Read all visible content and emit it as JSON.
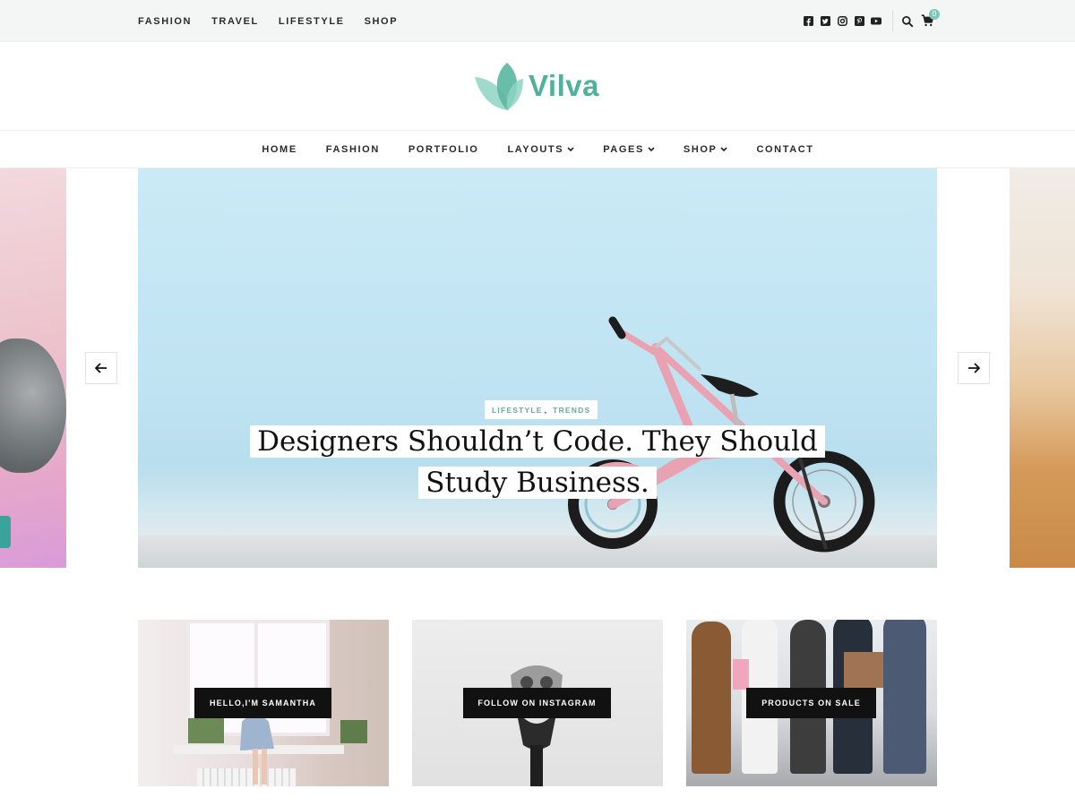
{
  "top_nav": [
    "Fashion",
    "Travel",
    "Lifestyle",
    "Shop"
  ],
  "social": [
    "facebook-icon",
    "twitter-icon",
    "instagram-icon",
    "pinterest-icon",
    "youtube-icon"
  ],
  "cart": {
    "count": "0"
  },
  "brand": {
    "name": "Vilva",
    "color": "#4fb09b"
  },
  "main_nav": [
    {
      "label": "Home",
      "dropdown": false
    },
    {
      "label": "Fashion",
      "dropdown": false
    },
    {
      "label": "Portfolio",
      "dropdown": false
    },
    {
      "label": "Layouts",
      "dropdown": true
    },
    {
      "label": "Pages",
      "dropdown": true
    },
    {
      "label": "Shop",
      "dropdown": true
    },
    {
      "label": "Contact",
      "dropdown": false
    }
  ],
  "slider": {
    "categories": [
      "LIFESTYLE",
      "TRENDS"
    ],
    "category_separator": ",",
    "title_line1": "Designers Shouldn’t Code. They Should",
    "title_line2": "Study Business."
  },
  "promos": [
    {
      "label": "HELLO,I'M SAMANTHA"
    },
    {
      "label": "FOLLOW ON INSTAGRAM"
    },
    {
      "label": "PRODUCTS ON SALE"
    }
  ]
}
